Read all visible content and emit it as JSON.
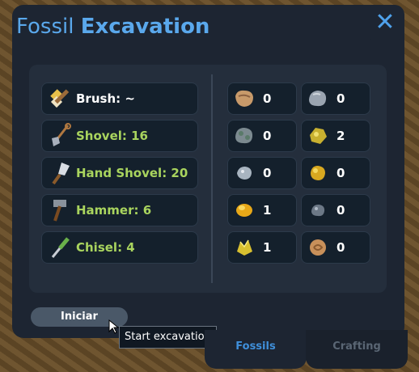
{
  "window": {
    "title_light": "Fossil",
    "title_bold": "Excavation",
    "close_label": "✕"
  },
  "tools": [
    {
      "label": "Brush: ~",
      "icon": "brush-icon"
    },
    {
      "label": "Shovel: 16",
      "icon": "shovel-icon"
    },
    {
      "label": "Hand Shovel: 20",
      "icon": "hand-shovel-icon"
    },
    {
      "label": "Hammer: 6",
      "icon": "hammer-icon"
    },
    {
      "label": "Chisel: 4",
      "icon": "chisel-icon"
    }
  ],
  "resources": [
    {
      "count": "0",
      "icon": "rough-stone-icon"
    },
    {
      "count": "0",
      "icon": "grey-rock-icon"
    },
    {
      "count": "0",
      "icon": "mossy-rock-icon"
    },
    {
      "count": "2",
      "icon": "gold-ore-icon"
    },
    {
      "count": "0",
      "icon": "silver-ore-icon"
    },
    {
      "count": "0",
      "icon": "golden-nugget-icon"
    },
    {
      "count": "1",
      "icon": "amber-icon"
    },
    {
      "count": "0",
      "icon": "iron-ore-icon"
    },
    {
      "count": "1",
      "icon": "gold-crystal-icon"
    },
    {
      "count": "0",
      "icon": "fossil-stone-icon"
    }
  ],
  "start_button": "Iniciar",
  "tooltip": "Start excavation",
  "tabs": {
    "fossils": "Fossils",
    "crafting": "Crafting"
  },
  "colors": {
    "accent": "#4fa2ec",
    "tool_text": "#a9d45e",
    "panel": "#1d2532"
  }
}
